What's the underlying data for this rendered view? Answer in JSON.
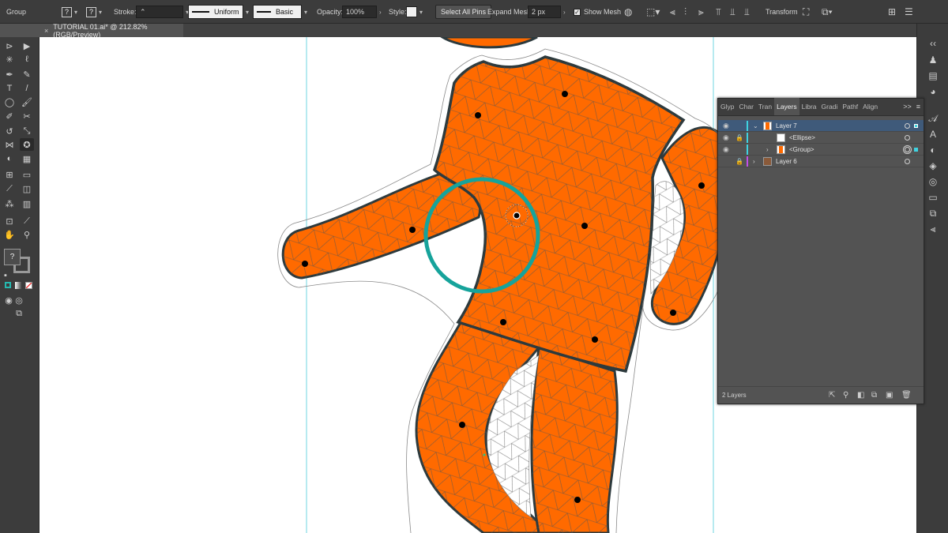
{
  "control_bar": {
    "selection": "Group",
    "stroke_label": "Stroke:",
    "stroke_profile": "Uniform",
    "brush": "Basic",
    "opacity_label": "Opacity:",
    "opacity_value": "100%",
    "style_label": "Style:",
    "select_all_pins": "Select All Pins",
    "expand_mesh_label": "Expand Mesh:",
    "expand_mesh_value": "2 px",
    "show_mesh_label": "Show Mesh",
    "show_mesh_checked": true,
    "transform_label": "Transform",
    "unknown_glyph": "?"
  },
  "document_tab": {
    "title": "TUTORIAL 01.ai* @ 212.82% (RGB/Preview)",
    "close_glyph": "×"
  },
  "tools_panel": {
    "items": [
      "selection-tool",
      "direct-selection-tool",
      "magic-wand-tool",
      "lasso-tool",
      "pen-tool",
      "curvature-tool",
      "type-tool",
      "line-tool",
      "ellipse-tool",
      "paintbrush-tool",
      "shaper-tool",
      "scissors-tool",
      "rotate-tool",
      "scale-tool",
      "width-tool",
      "puppet-warp-tool",
      "shape-builder-tool",
      "perspective-tool",
      "mesh-tool",
      "gradient-tool",
      "eyedropper-tool",
      "blend-tool",
      "symbol-sprayer-tool",
      "graph-tool",
      "artboard-tool",
      "slice-tool",
      "hand-tool",
      "zoom-tool"
    ],
    "fill_glyph": "?"
  },
  "layers_panel": {
    "tabs": [
      "Glyp",
      "Char",
      "Tran",
      "Layers",
      "Libra",
      "Gradi",
      "Pathf",
      "Align"
    ],
    "active_tab": "Layers",
    "expand_glyph": ">>",
    "menu_glyph": "≡",
    "rows": [
      {
        "name": "Layer 7",
        "selected": true,
        "color": "#3fd2e0"
      },
      {
        "name": "<Ellipse>",
        "selected": false,
        "color": "#3fd2e0"
      },
      {
        "name": "<Group>",
        "selected": false,
        "color": "#3fd2e0"
      },
      {
        "name": "Layer 6",
        "selected": false,
        "color": "#c24fe8"
      }
    ],
    "footer": "2 Layers"
  },
  "artwork": {
    "figure_color": "#ff6a00",
    "ring_color": "#16a39b",
    "outline_color": "#2d3a3d"
  }
}
